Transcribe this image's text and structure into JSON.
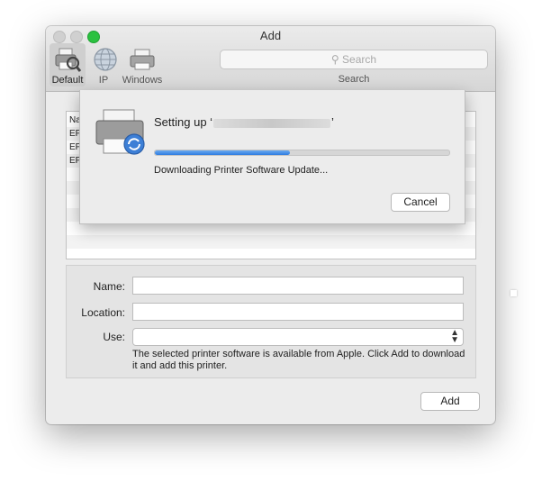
{
  "window": {
    "title": "Add"
  },
  "toolbar": {
    "items": [
      {
        "label": "Default",
        "icon": "printer-search-icon",
        "selected": true
      },
      {
        "label": "IP",
        "icon": "globe-icon",
        "selected": false
      },
      {
        "label": "Windows",
        "icon": "windows-printer-icon",
        "selected": false
      }
    ]
  },
  "search": {
    "placeholder": "Search",
    "caption": "Search"
  },
  "list": {
    "column_header": "Na",
    "rows": [
      "EP",
      "EP",
      "EP"
    ]
  },
  "form": {
    "name_label": "Name:",
    "name_value": "",
    "location_label": "Location:",
    "location_value": "",
    "use_label": "Use:",
    "use_value": "",
    "note": "The selected printer software is available from Apple. Click Add to download it and add this printer."
  },
  "add_button": "Add",
  "sheet": {
    "title_prefix": "Setting up ‘",
    "title_suffix": "’",
    "status": "Downloading Printer Software Update...",
    "progress_fraction": 0.46,
    "cancel_label": "Cancel"
  },
  "colors": {
    "accent": "#2f7de0",
    "zoom_button": "#2bc140"
  }
}
